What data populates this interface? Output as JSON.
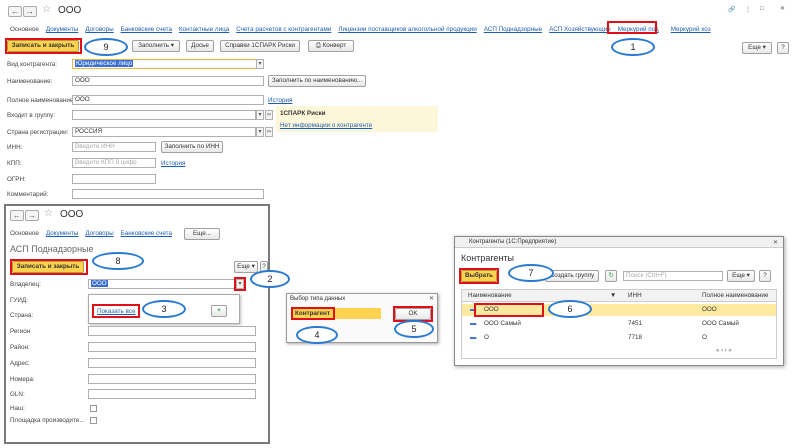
{
  "main": {
    "title": "ООО",
    "tabs": [
      "Основное",
      "Документы",
      "Договоры",
      "Банковские счета",
      "Контактные лица",
      "Счета расчетов с контрагентами",
      "Лицензии поставщиков алкогольной продукции",
      "АСП Поднадзорные",
      "АСП Хозяйствующие",
      "Меркурий под",
      "Меркурий хоз"
    ],
    "toolbar": {
      "save_close": "Записать и закрыть",
      "fill": "Заполнить",
      "dossier": "Досье",
      "refs": "Справки 1СПАРК Риски",
      "envelope": "Конверт",
      "more": "Еще",
      "help": "?"
    },
    "form": {
      "kind_label": "Вид контрагента:",
      "kind_value": "Юридическое лицо",
      "name_label": "Наименование:",
      "name_value": "ООО",
      "fill_by_name": "Заполнить по наименованию...",
      "full_label": "Полное наименование:",
      "full_value": "ООО",
      "history": "История",
      "group_label": "Входит в группу:",
      "country_label": "Страна регистрации:",
      "country_value": "РОССИЯ",
      "inn_label": "ИНН:",
      "inn_ph": "Введите ИНН",
      "fill_by_inn": "Заполнить по ИНН",
      "kpp_label": "КПП:",
      "kpp_ph": "Введите КПП 9 цифр",
      "history2": "История",
      "ogrn_label": "ОГРН:",
      "comment_label": "Комментарий:"
    },
    "spark": {
      "title": "1СПАРК Риски",
      "link": "Нет информации о контрагенте"
    }
  },
  "sub": {
    "title": "ООО",
    "tabs": [
      "Основное",
      "Документы",
      "Договоры",
      "Банковские счета"
    ],
    "more": "Еще...",
    "heading": "АСП Поднадзорные",
    "save_close": "Записать и закрыть",
    "more2": "Еще",
    "help": "?",
    "owner_label": "Владелец:",
    "owner_value": "ООО",
    "guid_label": "ГУИД:",
    "country_label": "Страна:",
    "region_label": "Регион",
    "district_label": "Район:",
    "address_label": "Адрес:",
    "numbers_label": "Номера:",
    "gln_label": "GLN:",
    "ours_label": "Наш:",
    "producer_label": "Площадка производите...",
    "show_all": "Показать все",
    "plus": "+"
  },
  "picker": {
    "title": "Выбор типа данных",
    "item": "Контрагент",
    "ok": "OK"
  },
  "contractors": {
    "title": "Контрагенты (1С:Предприятие)",
    "heading": "Контрагенты",
    "select": "Выбрать",
    "create_group": "Создать группу",
    "search_ph": "Поиск (Ctrl+F)",
    "more": "Еще",
    "help": "?",
    "columns": [
      "Наименование",
      "ИНН",
      "Полное наименование"
    ],
    "rows": [
      {
        "name": "ООО",
        "inn": "",
        "full": "ООО"
      },
      {
        "name": "ООО  Самый",
        "inn": "7451",
        "full": "ООО  Самый"
      },
      {
        "name": "О",
        "inn": "7718",
        "full": "О"
      }
    ]
  },
  "callouts": [
    "1",
    "2",
    "3",
    "4",
    "5",
    "6",
    "7",
    "8",
    "9"
  ],
  "colors": {
    "accent": "#fcd24f",
    "callout_border": "#2a7bd0",
    "highlight": "#e0101a",
    "link": "#1f5db3"
  }
}
